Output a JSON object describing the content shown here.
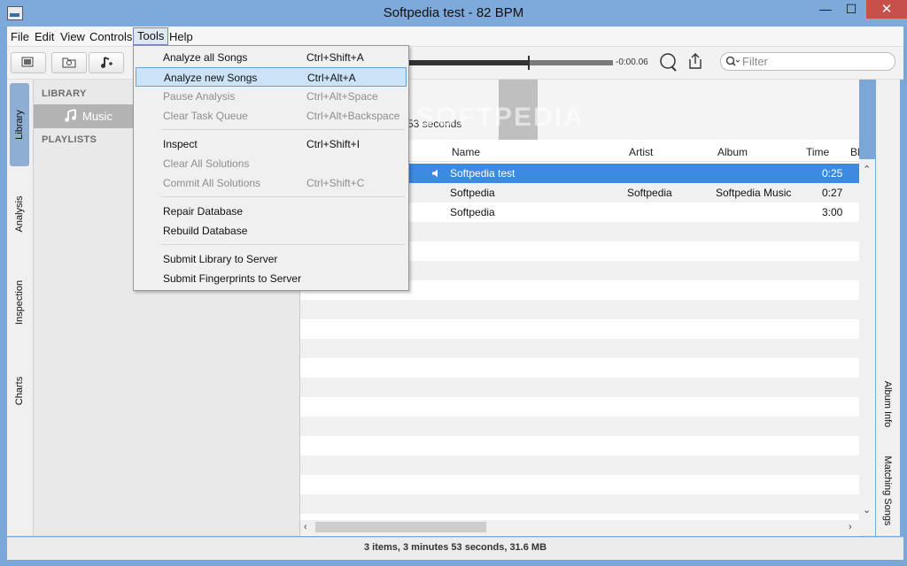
{
  "window": {
    "title": "Softpedia test - 82 BPM",
    "minimize": "—",
    "maximize": "☐",
    "close": "✕"
  },
  "menubar": [
    "File",
    "Edit",
    "View",
    "Controls",
    "Tools",
    "Help"
  ],
  "toolbar": {
    "time_remaining": "-0:00.06",
    "search_placeholder": "Filter",
    "progress_fraction": 0.63
  },
  "left_tabs": [
    "Library",
    "Analysis",
    "Inspection",
    "Charts"
  ],
  "sidebar": {
    "library_header": "LIBRARY",
    "music_item": "Music",
    "playlists_header": "PLAYLISTS"
  },
  "summary": "53 seconds",
  "watermark": "SOFTPEDIA",
  "table": {
    "columns": [
      "Name",
      "Artist",
      "Album",
      "Time",
      "Bl"
    ],
    "rows": [
      {
        "name": "Softpedia test",
        "artist": "",
        "album": "",
        "time": "0:25",
        "selected": true
      },
      {
        "name": "Softpedia",
        "artist": "Softpedia",
        "album": "Softpedia Music",
        "time": "0:27",
        "selected": false
      },
      {
        "name": "Softpedia",
        "artist": "",
        "album": "",
        "time": "3:00",
        "selected": false
      }
    ]
  },
  "right_tabs": [
    "Album Info",
    "Matching Songs"
  ],
  "status": "3 items, 3 minutes 53 seconds, 31.6 MB",
  "tools_menu": {
    "items": [
      {
        "label": "Analyze all Songs",
        "shortcut": "Ctrl+Shift+A",
        "enabled": true,
        "highlighted": false
      },
      {
        "label": "Analyze new Songs",
        "shortcut": "Ctrl+Alt+A",
        "enabled": true,
        "highlighted": true
      },
      {
        "label": "Pause Analysis",
        "shortcut": "Ctrl+Alt+Space",
        "enabled": false,
        "highlighted": false
      },
      {
        "label": "Clear Task Queue",
        "shortcut": "Ctrl+Alt+Backspace",
        "enabled": false,
        "highlighted": false
      },
      {
        "label": "Inspect",
        "shortcut": "Ctrl+Shift+I",
        "enabled": true,
        "highlighted": false
      },
      {
        "label": "Clear All Solutions",
        "shortcut": "",
        "enabled": false,
        "highlighted": false
      },
      {
        "label": "Commit All Solutions",
        "shortcut": "Ctrl+Shift+C",
        "enabled": false,
        "highlighted": false
      },
      {
        "label": "Repair Database",
        "shortcut": "",
        "enabled": true,
        "highlighted": false
      },
      {
        "label": "Rebuild Database",
        "shortcut": "",
        "enabled": true,
        "highlighted": false
      },
      {
        "label": "Submit Library to Server",
        "shortcut": "",
        "enabled": true,
        "highlighted": false
      },
      {
        "label": "Submit Fingerprints to Server",
        "shortcut": "",
        "enabled": true,
        "highlighted": false
      }
    ]
  }
}
